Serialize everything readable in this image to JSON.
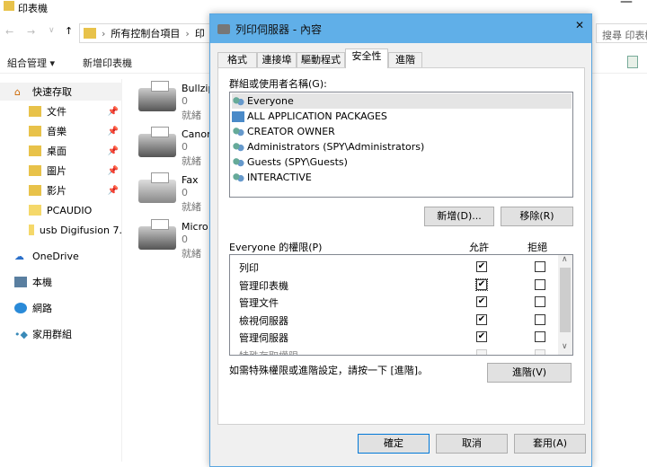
{
  "explorer": {
    "title": "印表機",
    "breadcrumb": [
      "所有控制台項目",
      "印"
    ],
    "search_placeholder": "搜尋 印表機",
    "toolbar": {
      "organize": "組合管理 ▾",
      "add_printer": "新增印表機"
    },
    "sidebar": [
      {
        "label": "快速存取",
        "icon": "star-icon",
        "pinned": false
      },
      {
        "label": "文件",
        "icon": "documents-icon",
        "pinned": true
      },
      {
        "label": "音樂",
        "icon": "music-icon",
        "pinned": true
      },
      {
        "label": "桌面",
        "icon": "desktop-icon",
        "pinned": true
      },
      {
        "label": "圖片",
        "icon": "pictures-icon",
        "pinned": true
      },
      {
        "label": "影片",
        "icon": "videos-icon",
        "pinned": true
      },
      {
        "label": "PCAUDIO",
        "icon": "folder-icon",
        "pinned": false
      },
      {
        "label": "usb Digifusion 7.",
        "icon": "folder-icon",
        "pinned": false
      },
      {
        "label": "OneDrive",
        "icon": "onedrive-icon",
        "pinned": false
      },
      {
        "label": "本機",
        "icon": "computer-icon",
        "pinned": false
      },
      {
        "label": "網路",
        "icon": "network-icon",
        "pinned": false
      },
      {
        "label": "家用群組",
        "icon": "homegroup-icon",
        "pinned": false
      }
    ],
    "printers": [
      {
        "name": "Bullzip",
        "count": "0",
        "status": "就緒"
      },
      {
        "name": "Canon",
        "count": "0",
        "status": "就緒"
      },
      {
        "name": "Fax",
        "count": "0",
        "status": "就緒"
      },
      {
        "name": "Micro",
        "count": "0",
        "status": "就緒"
      }
    ]
  },
  "dialog": {
    "title": "列印伺服器 - 內容",
    "tabs": [
      "格式",
      "連接埠",
      "驅動程式",
      "安全性",
      "進階"
    ],
    "active_tab": "安全性",
    "groups_label": "群組或使用者名稱(G):",
    "users": [
      "Everyone",
      "ALL APPLICATION PACKAGES",
      "CREATOR OWNER",
      "Administrators (SPY\\Administrators)",
      "Guests (SPY\\Guests)",
      "INTERACTIVE"
    ],
    "add_button": "新增(D)...",
    "remove_button": "移除(R)",
    "perm_label": "Everyone 的權限(P)",
    "allow_header": "允許",
    "deny_header": "拒絕",
    "permissions": [
      {
        "name": "列印",
        "allow": true,
        "deny": false
      },
      {
        "name": "管理印表機",
        "allow": true,
        "deny": false
      },
      {
        "name": "管理文件",
        "allow": true,
        "deny": false
      },
      {
        "name": "檢視伺服器",
        "allow": true,
        "deny": false
      },
      {
        "name": "管理伺服器",
        "allow": true,
        "deny": false
      },
      {
        "name": "特殊存取權限",
        "allow": false,
        "deny": false,
        "disabled": true
      }
    ],
    "advanced_text": "如需特殊權限或進階設定，請按一下 [進階]。",
    "advanced_button": "進階(V)",
    "ok": "確定",
    "cancel": "取消",
    "apply": "套用(A)"
  }
}
